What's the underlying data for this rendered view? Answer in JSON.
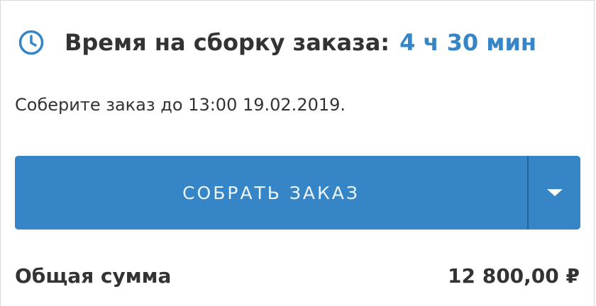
{
  "timer": {
    "icon": "clock-icon",
    "label": "Время на сборку заказа:",
    "value": "4 ч 30 мин",
    "accent_color": "#3585c7"
  },
  "deadline": {
    "text": "Соберите заказ до 13:00 19.02.2019."
  },
  "action": {
    "button_label": "СОБРАТЬ ЗАКАЗ",
    "dropdown_icon": "caret-down-icon",
    "button_color": "#3585c7"
  },
  "total": {
    "label": "Общая сумма",
    "value": "12 800,00 ₽"
  }
}
